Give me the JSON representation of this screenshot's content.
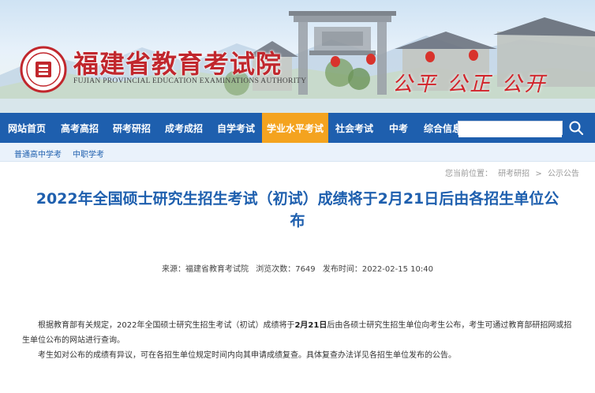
{
  "header": {
    "title": "福建省教育考试院",
    "subtitle": "FUJIAN PROVINCIAL EDUCATION EXAMINATIONS AUTHORITY",
    "slogan": "公平 公正 公开",
    "brand_color": "#c1272d"
  },
  "nav": {
    "items": [
      {
        "label": "网站首页",
        "active": false
      },
      {
        "label": "高考高招",
        "active": false
      },
      {
        "label": "研考研招",
        "active": false
      },
      {
        "label": "成考成招",
        "active": false
      },
      {
        "label": "自学考试",
        "active": false
      },
      {
        "label": "学业水平考试",
        "active": true
      },
      {
        "label": "社会考试",
        "active": false
      },
      {
        "label": "中考",
        "active": false
      },
      {
        "label": "综合信息",
        "active": false
      }
    ],
    "bg_color": "#1e5fae",
    "active_color": "#f4a31f",
    "search": {
      "value": "",
      "placeholder": "",
      "icon": "search-icon"
    }
  },
  "subnav": {
    "items": [
      "普通高中学考",
      "中职学考"
    ]
  },
  "breadcrumb": {
    "prefix": "您当前位置：",
    "items": [
      "研考研招",
      "公示公告"
    ],
    "separator": ">"
  },
  "article": {
    "title": "2022年全国硕士研究生招生考试（初试）成绩将于2月21日后由各招生单位公布",
    "meta": {
      "source": "来源：福建省教育考试院",
      "views": "浏览次数：7649",
      "published": "发布时间：2022-02-15 10:40"
    },
    "paragraph1_pre": "根据教育部有关规定，2022年全国硕士研究生招生考试（初试）成绩将于",
    "paragraph1_bold": "2月21日",
    "paragraph1_post": "后由各硕士研究生招生单位向考生公布，考生可通过教育部研招网或招生单位公布的网站进行查询。",
    "paragraph2": "考生如对公布的成绩有异议，可在各招生单位规定时间内向其申请成绩复查。具体复查办法详见各招生单位发布的公告。"
  }
}
